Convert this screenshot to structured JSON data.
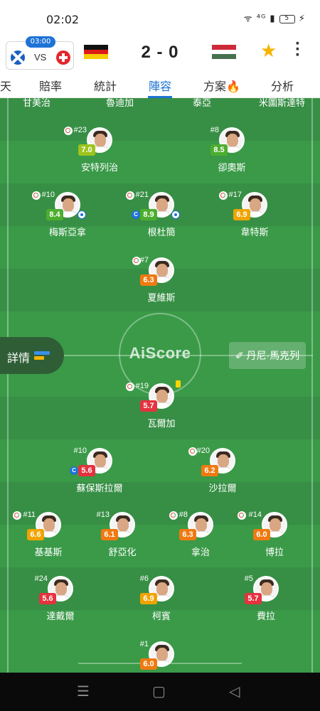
{
  "status_bar": {
    "time": "02:02",
    "icons": "ᯤ ⁴ᴳ ▮",
    "battery": "5"
  },
  "header": {
    "mini_match_time": "03:00",
    "mini_vs": "VS",
    "score": "2 - 0"
  },
  "tabs": [
    {
      "label": "天"
    },
    {
      "label": "賠率"
    },
    {
      "label": "統計"
    },
    {
      "label": "陣容"
    },
    {
      "label": "方案🔥"
    },
    {
      "label": "分析"
    }
  ],
  "top_names": [
    "甘美治",
    "魯迪加",
    "泰亞",
    "米圖斯達特"
  ],
  "pitch": {
    "watermark": "AiScore",
    "details_label": "詳情",
    "coach_label": "丹尼·馬克列"
  },
  "players": [
    {
      "number": "#23",
      "rating": "7.0",
      "rating_color": "#9dc41c",
      "name": "安特列治"
    },
    {
      "number": "#8",
      "rating": "8.5",
      "rating_color": "#4cae2e",
      "name": "卻奧斯"
    },
    {
      "number": "#10",
      "rating": "8.4",
      "rating_color": "#4cae2e",
      "name": "梅斯亞拿"
    },
    {
      "number": "#21",
      "rating": "8.9",
      "rating_color": "#4cae2e",
      "name": "根杜簡"
    },
    {
      "number": "#17",
      "rating": "6.9",
      "rating_color": "#f0a400",
      "name": "韋特斯"
    },
    {
      "number": "#7",
      "rating": "6.3",
      "rating_color": "#ef7a10",
      "name": "夏維斯"
    },
    {
      "number": "#19",
      "rating": "5.7",
      "rating_color": "#e5323f",
      "name": "瓦爾加"
    },
    {
      "number": "#10",
      "rating": "5.6",
      "rating_color": "#e5323f",
      "name": "蘇保斯拉爾"
    },
    {
      "number": "#20",
      "rating": "6.2",
      "rating_color": "#ef7a10",
      "name": "沙拉爾"
    },
    {
      "number": "#11",
      "rating": "6.6",
      "rating_color": "#f0a400",
      "name": "基基斯"
    },
    {
      "number": "#13",
      "rating": "6.1",
      "rating_color": "#ef7a10",
      "name": "舒亞化"
    },
    {
      "number": "#8",
      "rating": "6.3",
      "rating_color": "#ef7a10",
      "name": "拿治"
    },
    {
      "number": "#14",
      "rating": "6.0",
      "rating_color": "#ef7a10",
      "name": "博拉"
    },
    {
      "number": "#24",
      "rating": "5.6",
      "rating_color": "#e5323f",
      "name": "達戴爾"
    },
    {
      "number": "#6",
      "rating": "6.9",
      "rating_color": "#f0a400",
      "name": "柯賓"
    },
    {
      "number": "#5",
      "rating": "5.7",
      "rating_color": "#e5323f",
      "name": "費拉"
    },
    {
      "number": "#1",
      "rating": "6.0",
      "rating_color": "#ef7a10",
      "name": ""
    }
  ],
  "nav": {
    "menu": "☰",
    "home": "▢",
    "back": "◁"
  },
  "colors": {
    "accent": "#1e73d6",
    "pitch": "#3a9a48",
    "star": "#f6b400"
  }
}
